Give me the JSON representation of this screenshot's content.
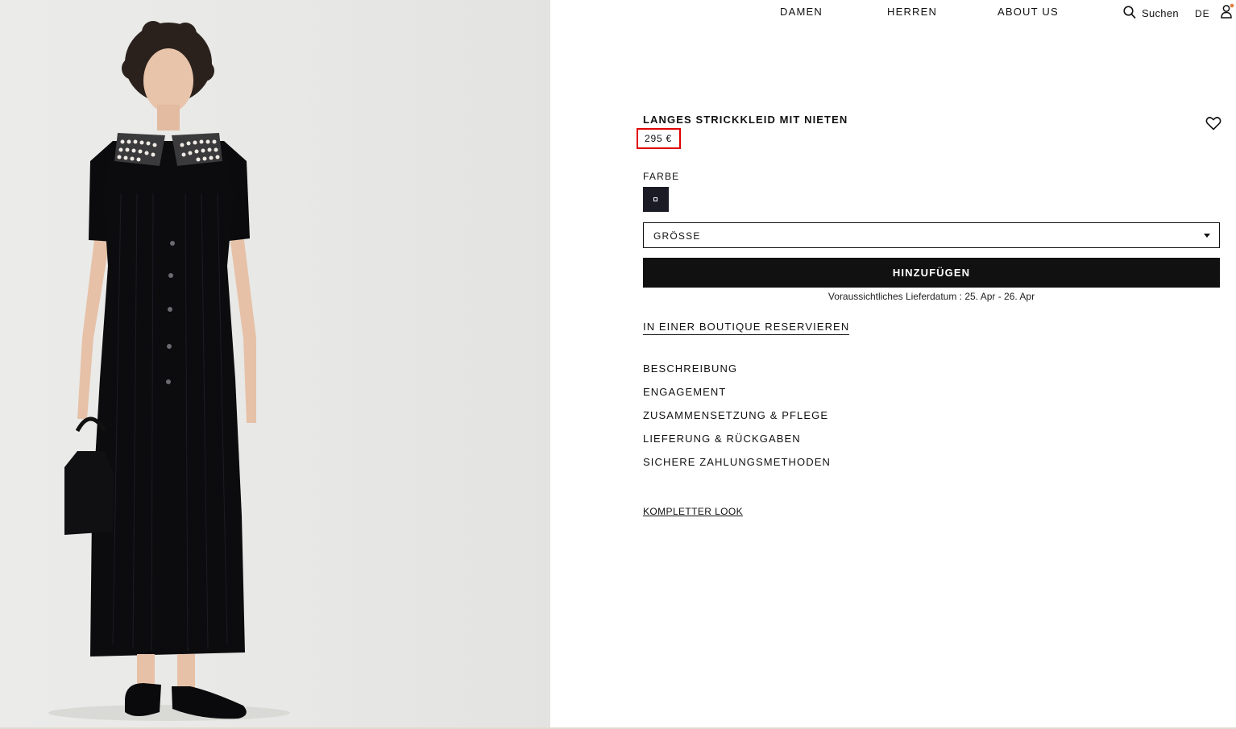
{
  "nav": {
    "items": [
      {
        "label": "DAMEN"
      },
      {
        "label": "HERREN"
      },
      {
        "label": "ABOUT US"
      }
    ],
    "search_label": "Suchen",
    "language": "DE",
    "search_icon": "search-icon",
    "account_icon": "user-icon"
  },
  "product": {
    "image_icon": "product-photo",
    "title": "LANGES STRICKKLEID MIT NIETEN",
    "price": "295 €",
    "wishlist_icon": "heart-icon",
    "color_label": "FARBE",
    "color_swatch": "#1b1b26",
    "size_placeholder": "GRÖSSE",
    "add_to_cart_label": "HINZUFÜGEN",
    "delivery_text": "Voraussichtliches Lieferdatum : 25. Apr - 26. Apr",
    "reserve_label": "IN EINER BOUTIQUE RESERVIEREN"
  },
  "accordion": [
    {
      "label": "BESCHREIBUNG"
    },
    {
      "label": "ENGAGEMENT"
    },
    {
      "label": "ZUSAMMENSETZUNG & PFLEGE"
    },
    {
      "label": "LIEFERUNG & RÜCKGABEN"
    },
    {
      "label": "SICHERE ZAHLUNGSMETHODEN"
    }
  ],
  "complete_look_label": "KOMPLETTER LOOK",
  "colors": {
    "highlight_border": "#e00000",
    "button_bg": "#111111",
    "notification_dot": "#e07a3a"
  }
}
